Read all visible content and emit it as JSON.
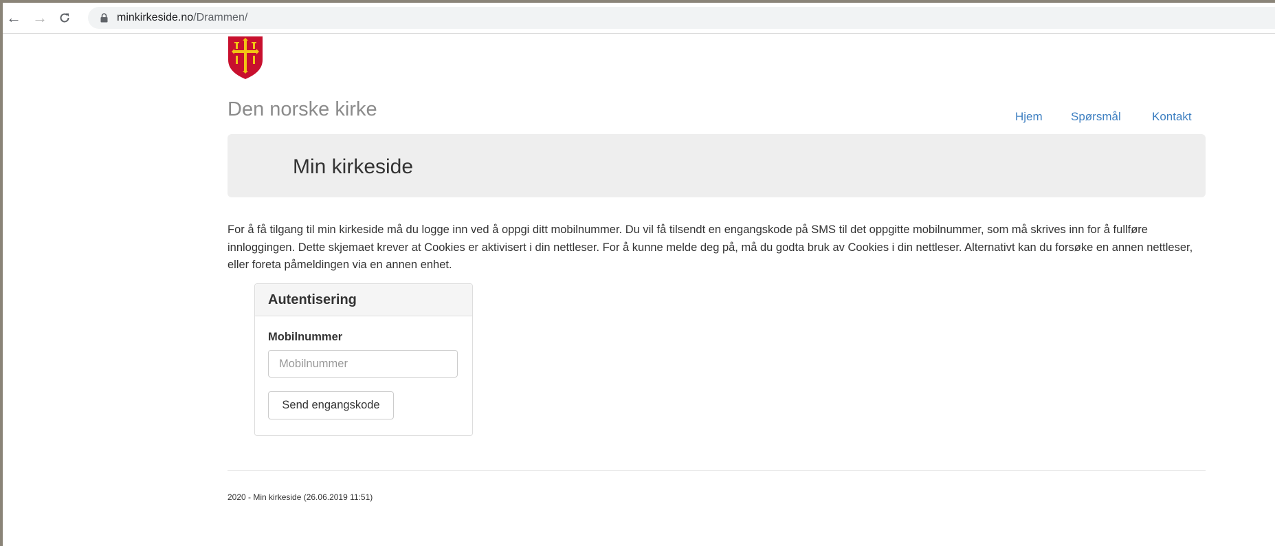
{
  "browser": {
    "url_host": "minkirkeside.no",
    "url_path": "/Drammen/"
  },
  "header": {
    "brand": "Den norske kirke",
    "nav": [
      "Hjem",
      "Spørsmål",
      "Kontakt"
    ]
  },
  "jumbotron": {
    "title": "Min kirkeside"
  },
  "intro": "For å få tilgang til min kirkeside må du logge inn ved å oppgi ditt mobilnummer. Du vil få tilsendt en engangskode på SMS til det oppgitte mobilnummer, som må skrives inn for å fullføre innloggingen. Dette skjemaet krever at Cookies er aktivisert i din nettleser. For å kunne melde deg på, må du godta bruk av Cookies i din nettleser. Alternativt kan du forsøke en annen nettleser, eller foreta påmeldingen via en annen enhet.",
  "auth": {
    "heading": "Autentisering",
    "field_label": "Mobilnummer",
    "field_placeholder": "Mobilnummer",
    "field_value": "",
    "button_label": "Send engangskode"
  },
  "footer": {
    "text": "2020 - Min kirkeside (26.06.2019 11:51)"
  },
  "colors": {
    "link": "#3d7fc1",
    "jumbotron_bg": "#eeeeee",
    "logo_red": "#c8102e",
    "logo_gold": "#f2c414"
  },
  "icons": [
    "back-arrow-icon",
    "forward-arrow-icon",
    "reload-icon",
    "lock-icon",
    "church-crest-logo"
  ]
}
